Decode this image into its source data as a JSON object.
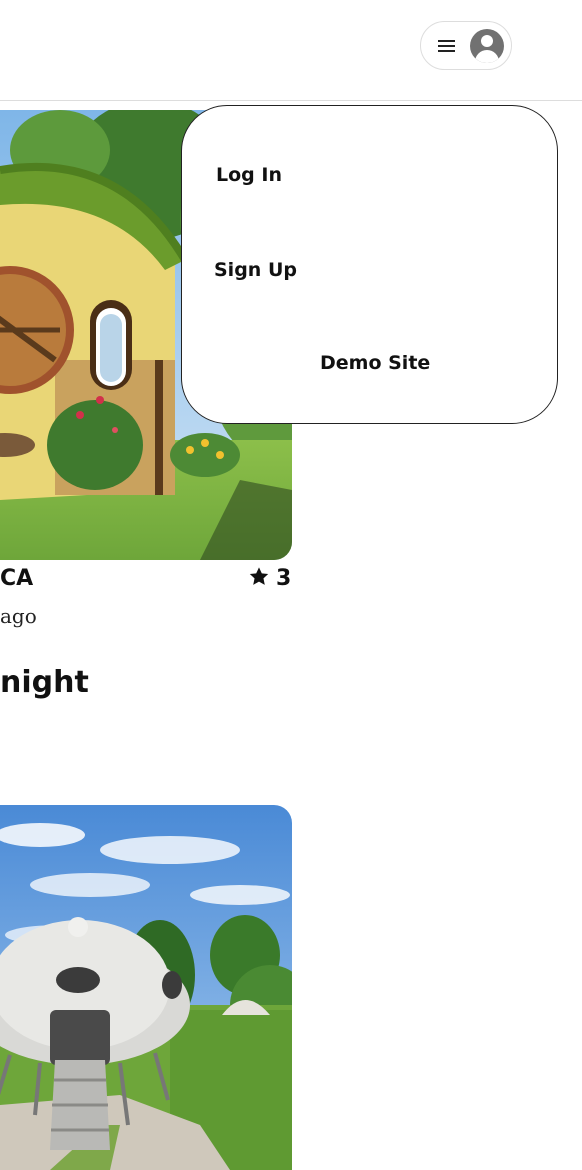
{
  "header": {
    "menu_icon": "hamburger-menu-icon",
    "avatar_icon": "user-avatar-icon"
  },
  "dropdown": {
    "login_label": "Log In",
    "signup_label": "Sign Up",
    "demo_label": "Demo Site"
  },
  "listings": [
    {
      "image_description_icon": "hobbit-house-photo",
      "location": "CA",
      "rating": "3",
      "rating_icon": "star-icon",
      "date": "ago",
      "price": "night"
    },
    {
      "image_description_icon": "ufo-pod-photo"
    }
  ],
  "colors": {
    "border": "#dddddd",
    "avatar": "#717171",
    "text": "#111111"
  }
}
